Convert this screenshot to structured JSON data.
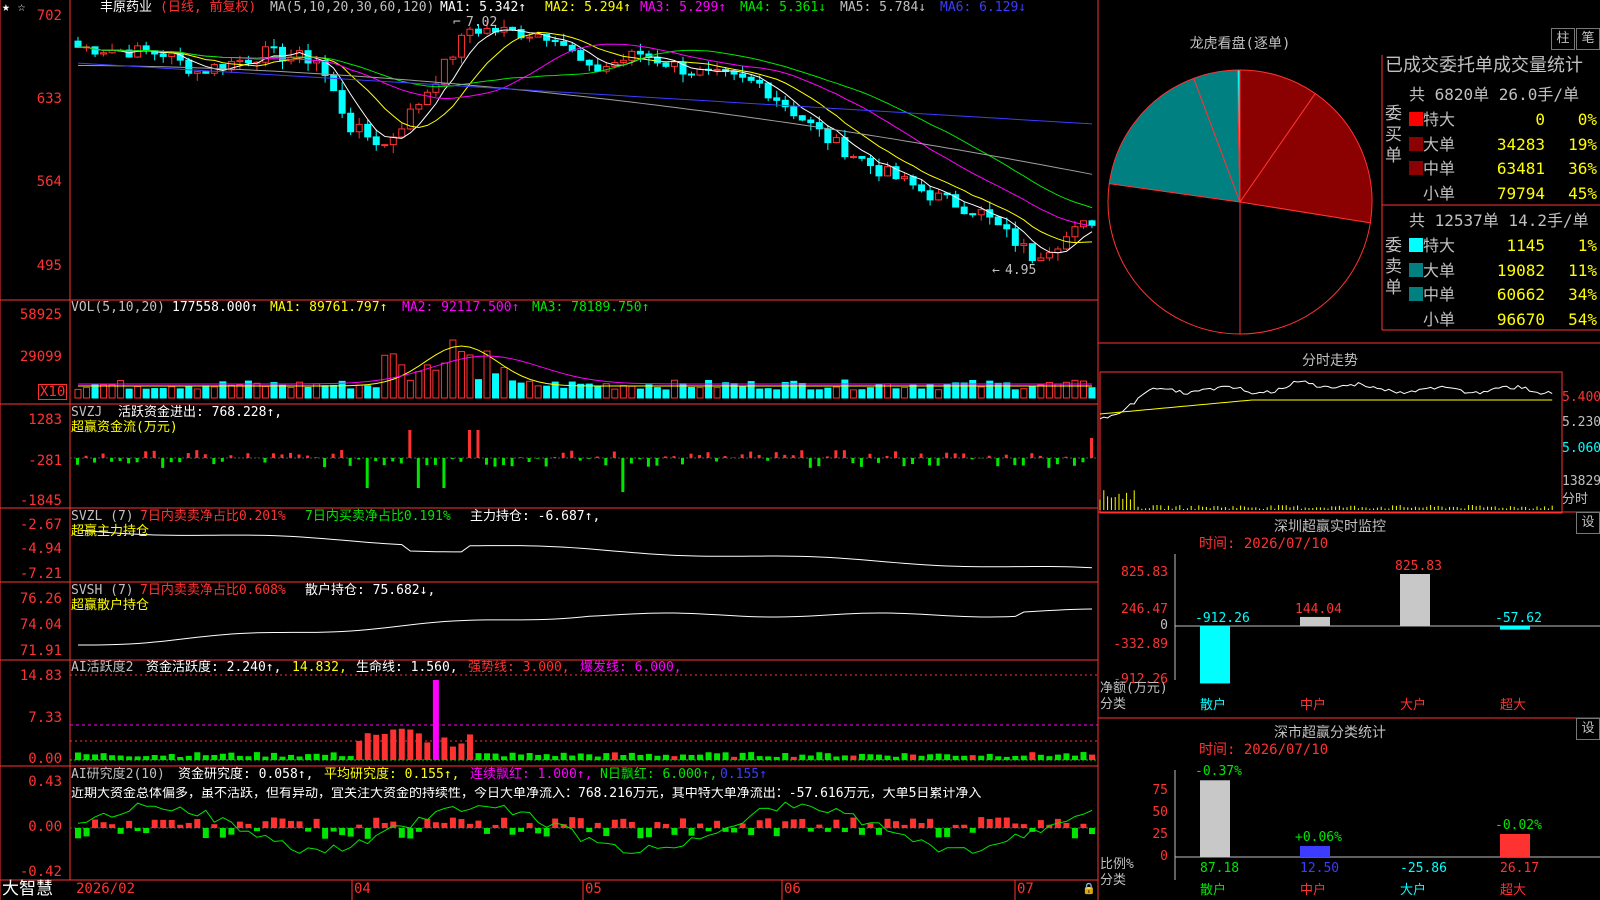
{
  "header": {
    "stock_name": "丰原药业",
    "period": "(日线, 前复权)",
    "ma_label": "MA(5,10,20,30,60,120)",
    "ma1": "MA1: 5.342↑",
    "ma2": "MA2: 5.294↑",
    "ma3": "MA3: 5.299↑",
    "ma4": "MA4: 5.361↓",
    "ma5": "MA5: 5.784↓",
    "ma6": "MA6: 6.129↓"
  },
  "price_chart": {
    "y_ticks": [
      "702",
      "633",
      "564",
      "495"
    ],
    "high_mark": "7.02",
    "low_mark": "4.95"
  },
  "volume_panel": {
    "title": "VOL(5,10,20)",
    "value": "177558.000↑",
    "ma1": "MA1: 89761.797↑",
    "ma2": "MA2: 92117.500↑",
    "ma3": "MA3: 78189.750↑",
    "y_ticks": [
      "58925",
      "29099"
    ],
    "unit": "X10"
  },
  "svzj_panel": {
    "title": "SVZJ",
    "text": "活跃资金进出: 768.228↑,",
    "subtitle": "超赢资金流(万元)",
    "y_ticks": [
      "1283",
      "-281",
      "-1845"
    ]
  },
  "svzl_panel": {
    "title": "SVZL (7)",
    "text_a": "7日内卖卖净占比0.201%",
    "text_b": "7日内买卖净占比0.191%",
    "text_c": "主力持仓: -6.687↑,",
    "subtitle": "超赢主力持仓",
    "y_ticks": [
      "-2.67",
      "-4.94",
      "-7.21"
    ]
  },
  "svsh_panel": {
    "title": "SVSH (7)",
    "text_a": "7日内卖卖净占比0.608%",
    "text_b": "散户持仓: 75.682↓,",
    "subtitle": "超赢散户持仓",
    "y_ticks": [
      "76.26",
      "74.04",
      "71.91"
    ]
  },
  "ai_active_panel": {
    "title": "AI活跃度2",
    "text_a": "资金活跃度: 2.240↑,",
    "text_b": "14.832,",
    "text_c": "生命线: 1.560,",
    "text_d": "强势线: 3.000,",
    "text_e": "爆发线: 6.000,",
    "y_ticks": [
      "14.83",
      "7.33",
      "0.00"
    ]
  },
  "ai_research_panel": {
    "title": "AI研究度2(10)",
    "text_a": "资金研究度: 0.058↑,",
    "text_b": "平均研究度: 0.155↑,",
    "text_c": "连续飘红: 1.000↑,",
    "text_d": "N日飘红: 6.000↑,",
    "text_e": "0.155↑",
    "commentary": "近期大资金总体偏多，虽不活跃，但有异动，宜关注大资金的持续性，今日大单净流入：768.216万元，其中特大单净流出：-57.616万元，大单5日累计净入",
    "y_ticks": [
      "0.43",
      "0.00",
      "-0.42"
    ]
  },
  "bottom_bar": {
    "brand": "大智慧",
    "dates": [
      "2026/02",
      "04",
      "05",
      "06",
      "07"
    ]
  },
  "dragon_tiger": {
    "title": "龙虎看盘(逐单)",
    "btn_bar": "柱",
    "btn_stroke": "笔",
    "table_title": "已成交委托单成交量统计",
    "buy_label": "委买单",
    "sell_label": "委卖单",
    "buy_summary": "共 6820单 26.0手/单",
    "sell_summary": "共 12537单 14.2手/单",
    "buy_rows": [
      {
        "name": "特大",
        "vol": "0",
        "pct": "0%",
        "color": "#ff0000"
      },
      {
        "name": "大单",
        "vol": "34283",
        "pct": "19%",
        "color": "#8b0000"
      },
      {
        "name": "中单",
        "vol": "63481",
        "pct": "36%",
        "color": "#8b0000"
      },
      {
        "name": "小单",
        "vol": "79794",
        "pct": "45%",
        "color": "#000000"
      }
    ],
    "sell_rows": [
      {
        "name": "特大",
        "vol": "1145",
        "pct": "1%",
        "color": "#00ffff"
      },
      {
        "name": "大单",
        "vol": "19082",
        "pct": "11%",
        "color": "#008080"
      },
      {
        "name": "中单",
        "vol": "60662",
        "pct": "34%",
        "color": "#008080"
      },
      {
        "name": "小单",
        "vol": "96670",
        "pct": "54%",
        "color": "#000000"
      }
    ],
    "pie_shares": [
      {
        "name": "买特大",
        "value": 0,
        "color": "#ff0000"
      },
      {
        "name": "买大单",
        "value": 34283,
        "color": "#8b0000"
      },
      {
        "name": "买中单",
        "value": 63481,
        "color": "#8b0000"
      },
      {
        "name": "买小单",
        "value": 79794,
        "color": "#000000"
      },
      {
        "name": "卖小单",
        "value": 96670,
        "color": "#000000"
      },
      {
        "name": "卖中单",
        "value": 60662,
        "color": "#008080"
      },
      {
        "name": "卖大单",
        "value": 19082,
        "color": "#008080"
      },
      {
        "name": "卖特大",
        "value": 1145,
        "color": "#00ffff"
      }
    ]
  },
  "intraday": {
    "title": "分时走势",
    "y_ticks": [
      "5.400",
      "5.230",
      "5.060"
    ],
    "vol_label": "13829",
    "footer": "分时"
  },
  "sz_monitor": {
    "title": "深圳超赢实时监控",
    "settings": "设",
    "time_label": "时间: 2026/07/10",
    "y_ticks": [
      "825.83",
      "246.47",
      "0",
      "-332.89",
      "-912.26"
    ],
    "unit_label": "净额(万元)",
    "category_label": "分类",
    "categories": [
      "散户",
      "中户",
      "大户",
      "超大"
    ],
    "values": [
      -912.26,
      144.04,
      825.83,
      -57.62
    ],
    "value_labels": [
      "-912.26",
      "144.04",
      "825.83",
      "-57.62"
    ]
  },
  "sz_classify": {
    "title": "深市超赢分类统计",
    "settings": "设",
    "time_label": "时间: 2026/07/10",
    "y_ticks": [
      "75",
      "50",
      "25",
      "0"
    ],
    "unit_label": "比例%",
    "category_label": "分类",
    "categories": [
      "散户",
      "中户",
      "大户",
      "超大"
    ],
    "values": [
      87.18,
      12.5,
      -25.86,
      26.17
    ],
    "value_labels": [
      "87.18",
      "12.50",
      "-25.86",
      "26.17"
    ],
    "change_labels": [
      "-0.37%",
      "+0.06%",
      "",
      "-0.02%"
    ]
  }
}
